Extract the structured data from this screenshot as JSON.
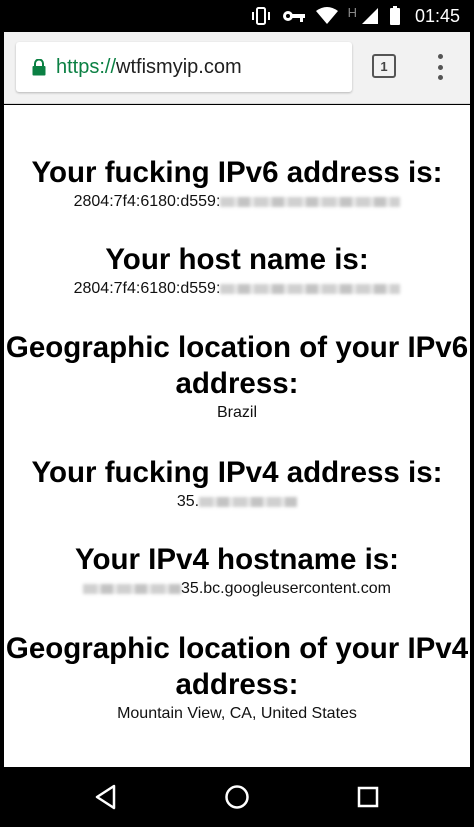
{
  "statusbar": {
    "network_label": "H",
    "time": "01:45"
  },
  "browser": {
    "url_scheme": "https://",
    "url_host": "wtfismyip.com",
    "tab_count": "1"
  },
  "page": {
    "ipv6_heading": "Your fucking IPv6 address is:",
    "ipv6_value": "2804:7f4:6180:d559:",
    "hostname_heading": "Your host name is:",
    "hostname_value": "2804:7f4:6180:d559:",
    "geo6_heading_line1": "Geographic location of your IPv6",
    "geo6_heading_line2": "address:",
    "geo6_value": "Brazil",
    "ipv4_heading": "Your fucking IPv4 address is:",
    "ipv4_value": "35.",
    "ipv4_hostname_heading": "Your IPv4 hostname is:",
    "ipv4_hostname_value": "35.bc.googleusercontent.com",
    "geo4_heading_line1": "Geographic location of your IPv4",
    "geo4_heading_line2": "address:",
    "geo4_value": "Mountain View, CA, United States"
  },
  "colors": {
    "url_scheme_green": "#0b8043",
    "toolbar_bg": "#f2f2f2"
  },
  "icons": [
    "vibrate-icon",
    "key-icon",
    "wifi-icon",
    "signal-icon",
    "battery-icon",
    "lock-icon",
    "tabs-icon",
    "overflow-menu-icon",
    "back-icon",
    "home-icon",
    "recents-icon"
  ]
}
